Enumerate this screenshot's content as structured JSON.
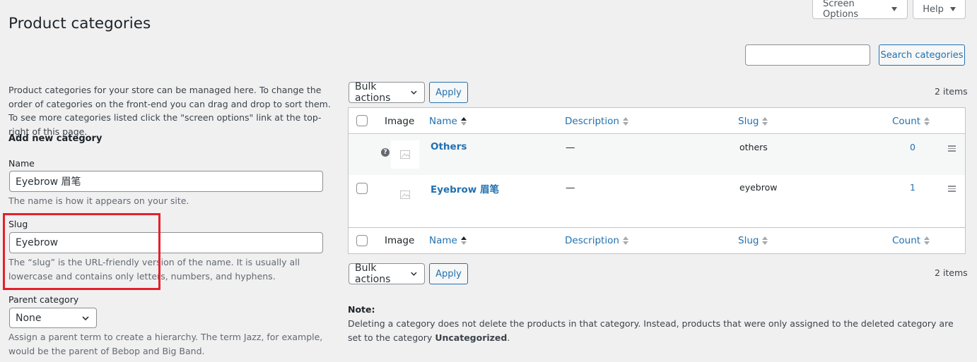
{
  "page_title": "Product categories",
  "top_tabs": {
    "screen_options": "Screen Options",
    "help": "Help"
  },
  "search": {
    "value": "",
    "placeholder": "",
    "button_label": "Search categories"
  },
  "intro_text": "Product categories for your store can be managed here. To change the order of categories on the front-end you can drag and drop to sort them. To see more categories listed click the \"screen options\" link at the top-right of this page.",
  "form": {
    "heading": "Add new category",
    "name_label": "Name",
    "name_value": "Eyebrow 眉笔",
    "name_desc": "The name is how it appears on your site.",
    "slug_label": "Slug",
    "slug_value": "Eyebrow",
    "slug_desc": "The “slug” is the URL-friendly version of the name. It is usually all lowercase and contains only letters, numbers, and hyphens.",
    "parent_label": "Parent category",
    "parent_value": "None",
    "parent_desc": "Assign a parent term to create a hierarchy. The term Jazz, for example, would be the parent of Bebop and Big Band."
  },
  "bulk": {
    "label": "Bulk actions",
    "apply": "Apply",
    "items_count": "2 items"
  },
  "table": {
    "columns": {
      "image": "Image",
      "name": "Name",
      "description": "Description",
      "slug": "Slug",
      "count": "Count"
    },
    "rows": [
      {
        "name": "Others",
        "description": "—",
        "slug": "others",
        "count": "0"
      },
      {
        "name": "Eyebrow 眉笔",
        "description": "—",
        "slug": "eyebrow",
        "count": "1"
      }
    ]
  },
  "note": {
    "heading": "Note:",
    "text": "Deleting a category does not delete the products in that category. Instead, products that were only assigned to the deleted category are set to the category",
    "bold": "Uncategorized",
    "end": "."
  },
  "colors": {
    "accent": "#2271b1",
    "highlight": "#e4202a",
    "background": "#f0f0f1"
  }
}
